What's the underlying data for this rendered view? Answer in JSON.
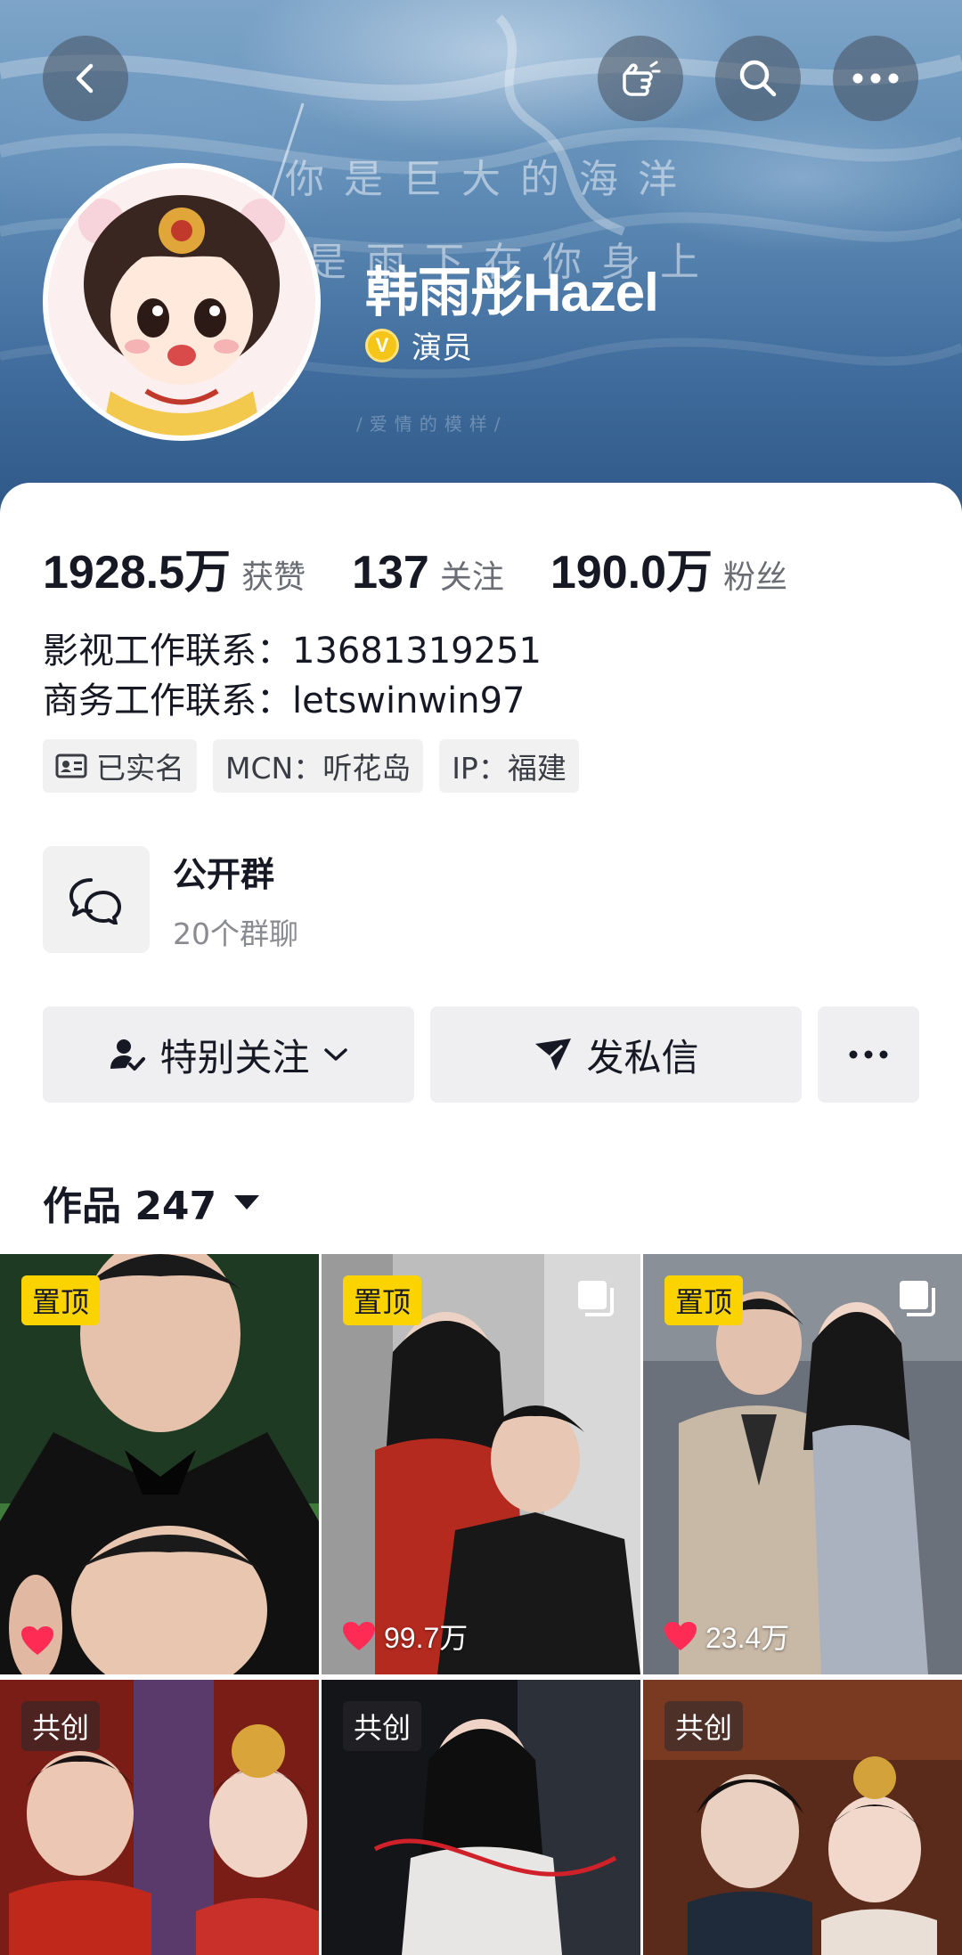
{
  "header": {
    "poem_line_1": "你是巨大的海洋",
    "poem_line_2": "是雨下在你身上",
    "poem_line_3": "/爱情的模样/"
  },
  "profile": {
    "name": "韩雨彤Hazel",
    "verified_icon": "v-badge-icon",
    "verified_title": "演员"
  },
  "stats": [
    {
      "value": "1928.5万",
      "label": "获赞"
    },
    {
      "value": "137",
      "label": "关注"
    },
    {
      "value": "190.0万",
      "label": "粉丝"
    }
  ],
  "bio": {
    "line_1": "影视工作联系：13681319251",
    "line_2": "商务工作联系：letswinwin97"
  },
  "tags": [
    {
      "icon": "id-card-icon",
      "label": "已实名"
    },
    {
      "label": "MCN：听花岛"
    },
    {
      "label": "IP：福建"
    }
  ],
  "group": {
    "title": "公开群",
    "subtitle": "20个群聊"
  },
  "actions": {
    "follow_label": "特别关注",
    "message_label": "发私信"
  },
  "works": {
    "label": "作品 247"
  },
  "grid": [
    {
      "badge": "置顶",
      "badge_type": "pin",
      "likes": "",
      "multi": false
    },
    {
      "badge": "置顶",
      "badge_type": "pin",
      "likes": "99.7万",
      "multi": true
    },
    {
      "badge": "置顶",
      "badge_type": "pin",
      "likes": "23.4万",
      "multi": true
    },
    {
      "badge": "共创",
      "badge_type": "co",
      "likes": "",
      "multi": false
    },
    {
      "badge": "共创",
      "badge_type": "co",
      "likes": "",
      "multi": false
    },
    {
      "badge": "共创",
      "badge_type": "co",
      "likes": "",
      "multi": false
    }
  ],
  "colors": {
    "pin_badge": "#fbd400",
    "like_heart": "#fe2c55",
    "verify_badge": "#f5c518"
  }
}
